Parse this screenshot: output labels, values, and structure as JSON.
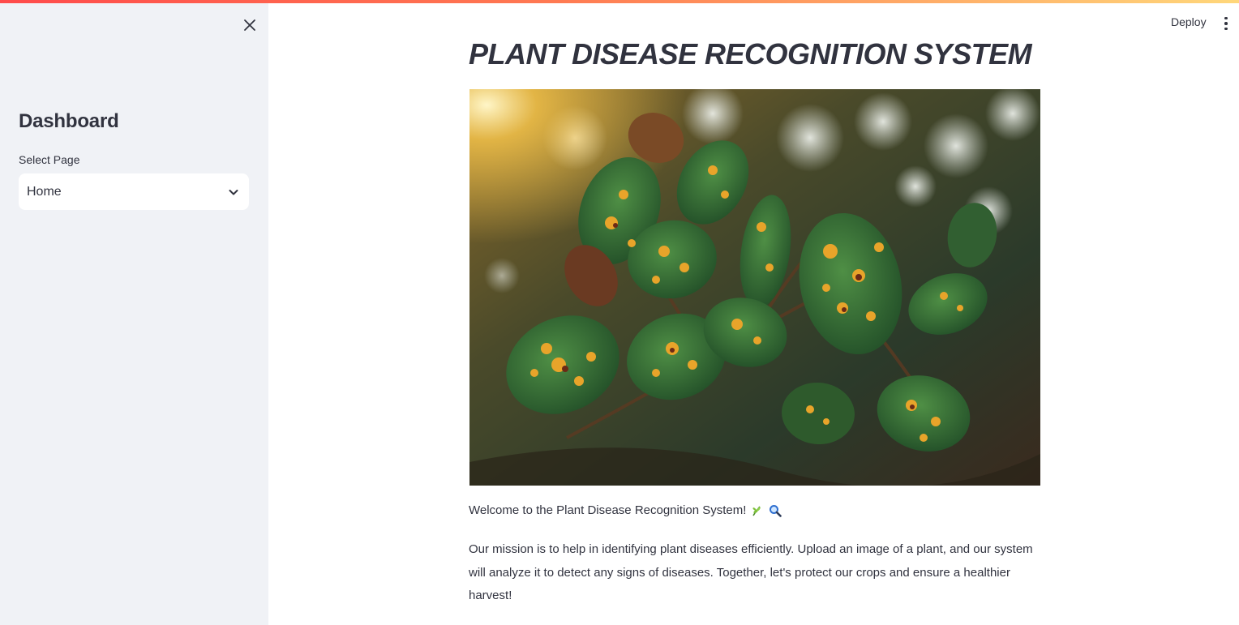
{
  "sidebar": {
    "title": "Dashboard",
    "select_label": "Select Page",
    "select_value": "Home",
    "close_icon": "close-icon",
    "chevron_icon": "chevron-down-icon"
  },
  "header": {
    "deploy_label": "Deploy",
    "menu_icon": "kebab-menu-icon"
  },
  "main": {
    "title": "PLANT DISEASE RECOGNITION SYSTEM",
    "welcome_text": "Welcome to the Plant Disease Recognition System!",
    "mission_text": "Our mission is to help in identifying plant diseases efficiently. Upload an image of a plant, and our system will analyze it to detect any signs of diseases. Together, let's protect our crops and ensure a healthier harvest!",
    "hero_image": "diseased-plant-leaves-photo"
  },
  "colors": {
    "sidebar_bg": "#f0f2f6",
    "text": "#31333f",
    "accent": "#ff4b4b"
  }
}
